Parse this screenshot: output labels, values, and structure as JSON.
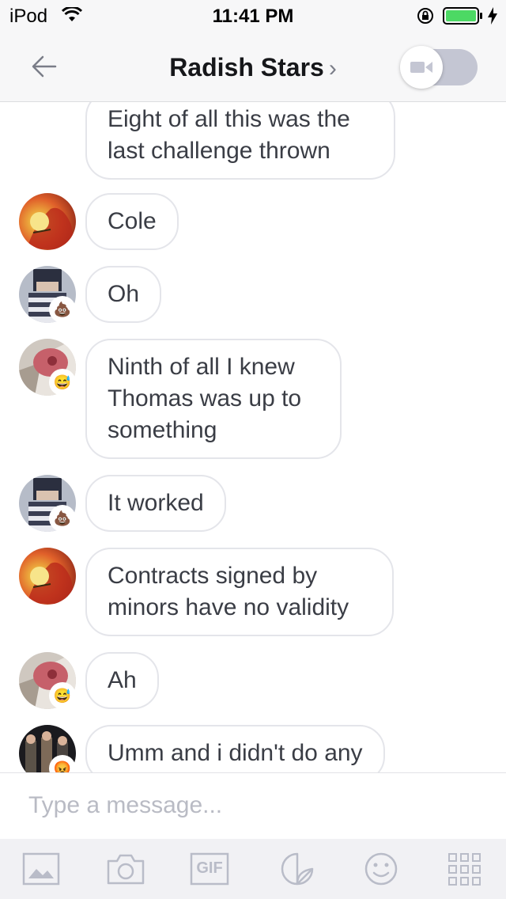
{
  "status_bar": {
    "carrier": "iPod",
    "time": "11:41 PM"
  },
  "header": {
    "title": "Radish Stars",
    "chevron": "›"
  },
  "messages": [
    {
      "text": "Eight of all this was the last challenge thrown",
      "avatar": "none"
    },
    {
      "text": "Cole",
      "avatar": "red-haired-drawing",
      "badge": ""
    },
    {
      "text": "Oh",
      "avatar": "striped-hoodie-character",
      "badge": "💩"
    },
    {
      "text": "Ninth of all I knew Thomas was up to something",
      "avatar": "pink-blob",
      "badge": "😅"
    },
    {
      "text": "It worked",
      "avatar": "striped-hoodie-character",
      "badge": "💩"
    },
    {
      "text": "Contracts signed by minors have no validity",
      "avatar": "red-haired-drawing",
      "badge": ""
    },
    {
      "text": "Ah",
      "avatar": "pink-blob",
      "badge": "😅"
    },
    {
      "text": "Umm and i didn't do any",
      "avatar": "group-photo",
      "badge": "😡"
    }
  ],
  "composer": {
    "placeholder": "Type a message..."
  },
  "toolbar": {
    "gif_label": "GIF"
  },
  "colors": {
    "bubble_border": "#e4e5ea",
    "toggle_track": "#c4c6d3",
    "icon_gray": "#b9bcc8"
  }
}
